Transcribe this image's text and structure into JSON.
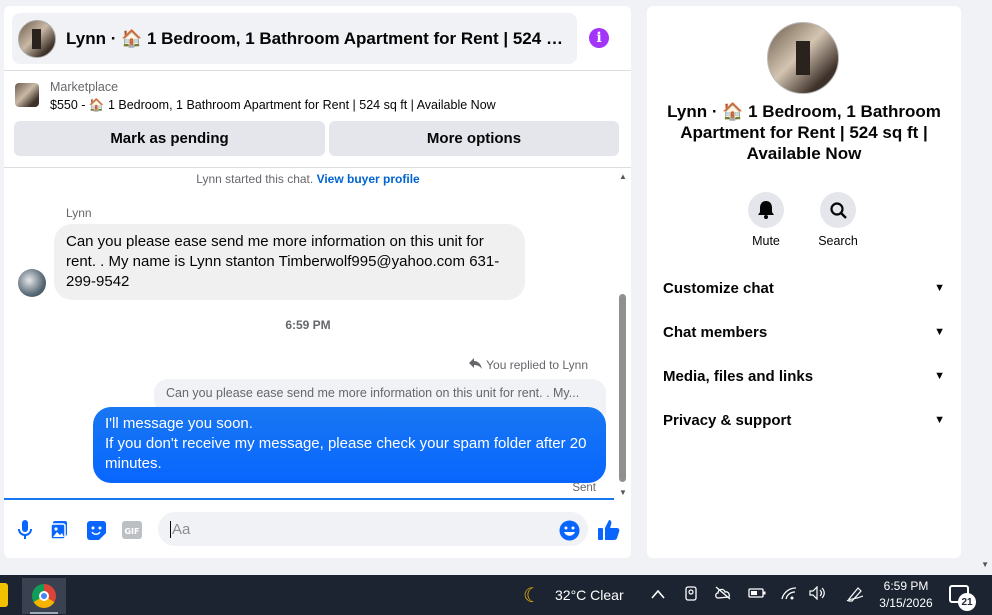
{
  "chat": {
    "header_title": "Lynn · 🏠 1 Bedroom, 1 Bathroom Apartment for Rent | 524 sq ft · Available Now",
    "marketplace_label": "Marketplace",
    "listing_desc": "$550 - 🏠 1 Bedroom, 1 Bathroom Apartment for Rent | 524 sq ft | Available Now",
    "mark_pending": "Mark as pending",
    "more_options": "More options",
    "started_text": "Lynn started this chat.",
    "view_profile": "View buyer profile",
    "sender_name": "Lynn",
    "incoming_message": "Can you please ease send me more information on this unit for rent. . My name is Lynn stanton Timberwolf995@yahoo.com  631-299-9542",
    "time_divider": "6:59 PM",
    "replied_label": "You replied to Lynn",
    "quoted_message": "Can you please ease send me more information on this unit for rent. . My...",
    "outgoing_line1": "I'll message you soon.",
    "outgoing_line2": "If you don't receive my message, please check your spam folder after 20 minutes.",
    "sent_status": "Sent",
    "composer_placeholder": "Aa"
  },
  "info": {
    "title": "Lynn · 🏠 1 Bedroom, 1 Bathroom Apartment for Rent | 524 sq ft | Available Now",
    "mute_label": "Mute",
    "search_label": "Search",
    "sections": [
      "Customize chat",
      "Chat members",
      "Media, files and links",
      "Privacy & support"
    ]
  },
  "taskbar": {
    "weather": "32°C  Clear",
    "time": "6:59 PM",
    "date": "3/15/2026",
    "notification_count": "21"
  },
  "colors": {
    "accent": "#0866ff",
    "info_icon": "#a334fa",
    "link": "#0064d1"
  }
}
